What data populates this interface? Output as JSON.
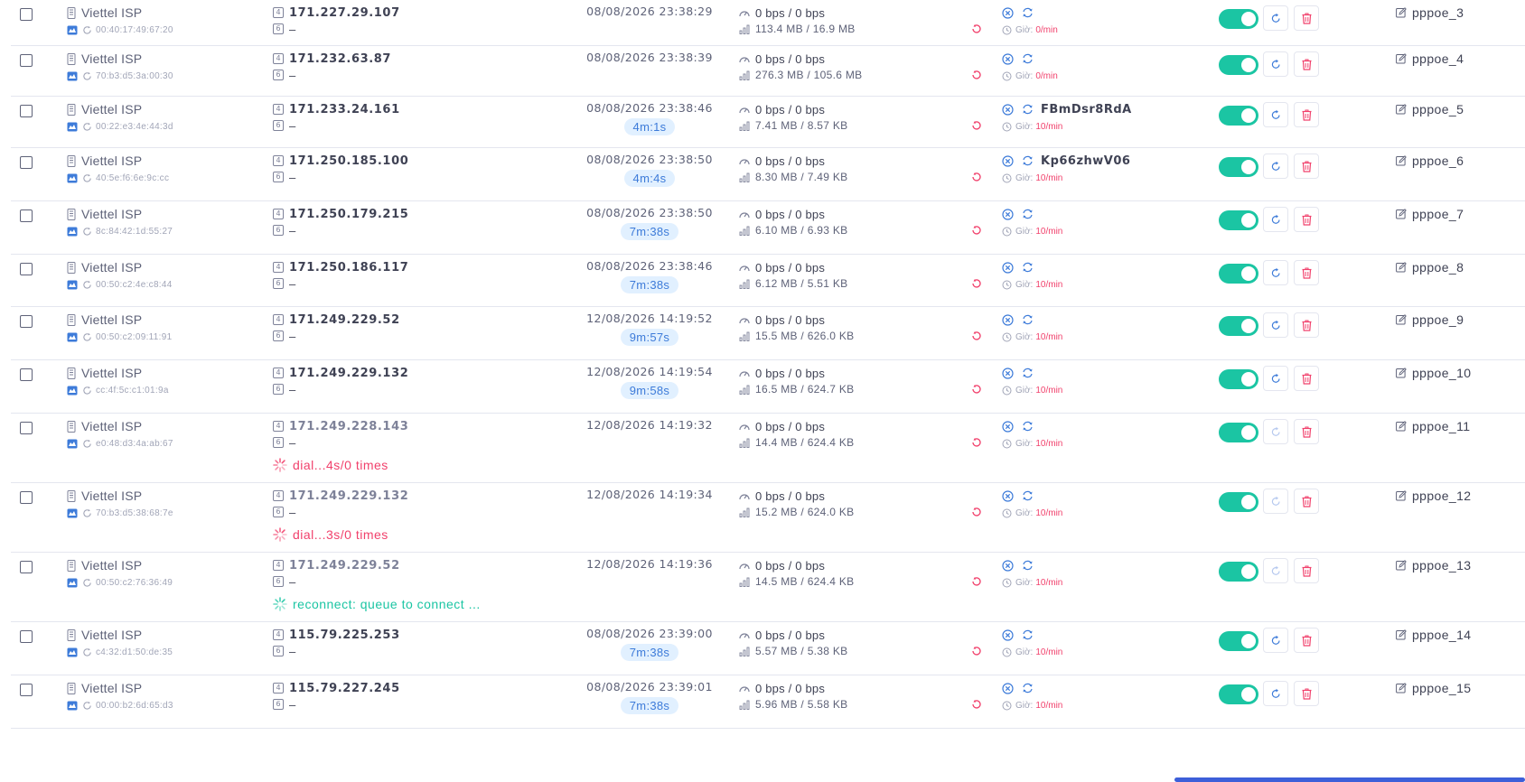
{
  "colors": {
    "accent": "#1bc5a3",
    "danger": "#f1416c",
    "primary": "#3d7bd9",
    "badge_bg": "#e1f0ff"
  },
  "icons": {
    "isp": "server-icon",
    "mac": "network-icon",
    "refresh": "refresh-icon",
    "delete": "trash-icon",
    "edit": "edit-icon",
    "speed": "speedometer-icon",
    "usage": "bar-chart-icon",
    "close": "close-circle-icon",
    "rotate": "rotate-icon",
    "clock": "clock-icon",
    "reset": "reset-icon",
    "loading": "loading-spinner-icon"
  },
  "labels": {
    "ip6_empty": "–",
    "rate_prefix": "Giờ:",
    "v4": "4",
    "v6": "6"
  },
  "rows": [
    {
      "isp": "Viettel ISP",
      "mac": "00:40:17:49:67:20",
      "ip": "171.227.29.107",
      "ip_dim": false,
      "datetime": "08/08/2026 23:38:29",
      "uptime": "",
      "speed": "0 bps / 0 bps",
      "usage": "113.4 MB / 16.9 MB",
      "account": "",
      "rate": "0/min",
      "name": "pppoe_3",
      "status": "",
      "status_type": "",
      "height": 62
    },
    {
      "isp": "Viettel ISP",
      "mac": "70:b3:d5:3a:00:30",
      "ip": "171.232.63.87",
      "ip_dim": false,
      "datetime": "08/08/2026 23:38:39",
      "uptime": "",
      "speed": "0 bps / 0 bps",
      "usage": "276.3 MB / 105.6 MB",
      "account": "",
      "rate": "0/min",
      "name": "pppoe_4",
      "status": "",
      "status_type": "",
      "height": 62
    },
    {
      "isp": "Viettel ISP",
      "mac": "00:22:e3:4e:44:3d",
      "ip": "171.233.24.161",
      "ip_dim": false,
      "datetime": "08/08/2026 23:38:46",
      "uptime": "4m:1s",
      "speed": "0 bps / 0 bps",
      "usage": "7.41 MB / 8.57 KB",
      "account": "FBmDsr8RdA",
      "rate": "10/min",
      "name": "pppoe_5",
      "status": "",
      "status_type": "",
      "height": 65
    },
    {
      "isp": "Viettel ISP",
      "mac": "40:5e:f6:6e:9c:cc",
      "ip": "171.250.185.100",
      "ip_dim": false,
      "datetime": "08/08/2026 23:38:50",
      "uptime": "4m:4s",
      "speed": "0 bps / 0 bps",
      "usage": "8.30 MB / 7.49 KB",
      "account": "Kp66zhwV06",
      "rate": "10/min",
      "name": "pppoe_6",
      "status": "",
      "status_type": "",
      "height": 63
    },
    {
      "isp": "Viettel ISP",
      "mac": "8c:84:42:1d:55:27",
      "ip": "171.250.179.215",
      "ip_dim": false,
      "datetime": "08/08/2026 23:38:50",
      "uptime": "7m:38s",
      "speed": "0 bps / 0 bps",
      "usage": "6.10 MB / 6.93 KB",
      "account": "",
      "rate": "10/min",
      "name": "pppoe_7",
      "status": "",
      "status_type": "",
      "height": 63
    },
    {
      "isp": "Viettel ISP",
      "mac": "00:50:c2:4e:c8:44",
      "ip": "171.250.186.117",
      "ip_dim": false,
      "datetime": "08/08/2026 23:38:46",
      "uptime": "7m:38s",
      "speed": "0 bps / 0 bps",
      "usage": "6.12 MB / 5.51 KB",
      "account": "",
      "rate": "10/min",
      "name": "pppoe_8",
      "status": "",
      "status_type": "",
      "height": 63
    },
    {
      "isp": "Viettel ISP",
      "mac": "00:50:c2:09:11:91",
      "ip": "171.249.229.52",
      "ip_dim": false,
      "datetime": "12/08/2026 14:19:52",
      "uptime": "9m:57s",
      "speed": "0 bps / 0 bps",
      "usage": "15.5 MB / 626.0 KB",
      "account": "",
      "rate": "10/min",
      "name": "pppoe_9",
      "status": "",
      "status_type": "",
      "height": 63
    },
    {
      "isp": "Viettel ISP",
      "mac": "cc:4f:5c:c1:01:9a",
      "ip": "171.249.229.132",
      "ip_dim": false,
      "datetime": "12/08/2026 14:19:54",
      "uptime": "9m:58s",
      "speed": "0 bps / 0 bps",
      "usage": "16.5 MB / 624.7 KB",
      "account": "",
      "rate": "10/min",
      "name": "pppoe_10",
      "status": "",
      "status_type": "",
      "height": 63
    },
    {
      "isp": "Viettel ISP",
      "mac": "e0:48:d3:4a:ab:67",
      "ip": "171.249.228.143",
      "ip_dim": true,
      "datetime": "12/08/2026 14:19:32",
      "uptime": "",
      "speed": "0 bps / 0 bps",
      "usage": "14.4 MB / 624.4 KB",
      "account": "",
      "rate": "10/min",
      "name": "pppoe_11",
      "status": "dial...4s/0 times",
      "status_type": "err",
      "height": 83
    },
    {
      "isp": "Viettel ISP",
      "mac": "70:b3:d5:38:68:7e",
      "ip": "171.249.229.132",
      "ip_dim": true,
      "datetime": "12/08/2026 14:19:34",
      "uptime": "",
      "speed": "0 bps / 0 bps",
      "usage": "15.2 MB / 624.0 KB",
      "account": "",
      "rate": "10/min",
      "name": "pppoe_12",
      "status": "dial...3s/0 times",
      "status_type": "err",
      "height": 83
    },
    {
      "isp": "Viettel ISP",
      "mac": "00:50:c2:76:36:49",
      "ip": "171.249.229.52",
      "ip_dim": true,
      "datetime": "12/08/2026 14:19:36",
      "uptime": "",
      "speed": "0 bps / 0 bps",
      "usage": "14.5 MB / 624.4 KB",
      "account": "",
      "rate": "10/min",
      "name": "pppoe_13",
      "status": "reconnect: queue to connect ...",
      "status_type": "ok",
      "height": 83
    },
    {
      "isp": "Viettel ISP",
      "mac": "c4:32:d1:50:de:35",
      "ip": "115.79.225.253",
      "ip_dim": false,
      "datetime": "08/08/2026 23:39:00",
      "uptime": "7m:38s",
      "speed": "0 bps / 0 bps",
      "usage": "5.57 MB / 5.38 KB",
      "account": "",
      "rate": "10/min",
      "name": "pppoe_14",
      "status": "",
      "status_type": "",
      "height": 63
    },
    {
      "isp": "Viettel ISP",
      "mac": "00:00:b2:6d:65:d3",
      "ip": "115.79.227.245",
      "ip_dim": false,
      "datetime": "08/08/2026 23:39:01",
      "uptime": "7m:38s",
      "speed": "0 bps / 0 bps",
      "usage": "5.96 MB / 5.58 KB",
      "account": "",
      "rate": "10/min",
      "name": "pppoe_15",
      "status": "",
      "status_type": "",
      "height": 63
    }
  ]
}
